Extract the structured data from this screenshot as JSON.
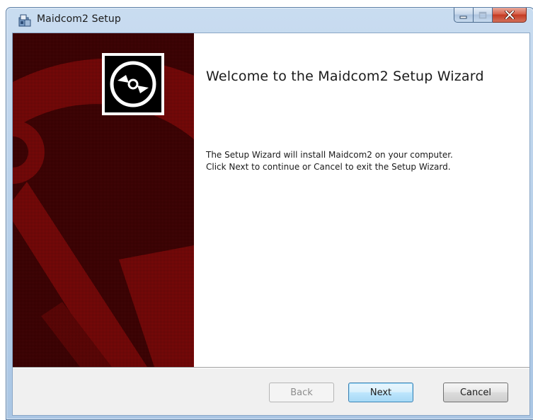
{
  "window": {
    "title": "Maidcom2 Setup",
    "caption_buttons": {
      "minimize": "minimize-icon",
      "maximize": "maximize-icon",
      "close": "close-icon"
    }
  },
  "banner": {
    "icon": "disc-icon",
    "colors": {
      "dark": "#4a0405",
      "red": "#8b0a0a"
    }
  },
  "content": {
    "heading": "Welcome to the Maidcom2 Setup Wizard",
    "line1": "The Setup Wizard will install Maidcom2 on your computer.",
    "line2": "Click Next to continue or Cancel to exit the Setup Wizard."
  },
  "buttons": {
    "back": "Back",
    "next": "Next",
    "cancel": "Cancel"
  }
}
